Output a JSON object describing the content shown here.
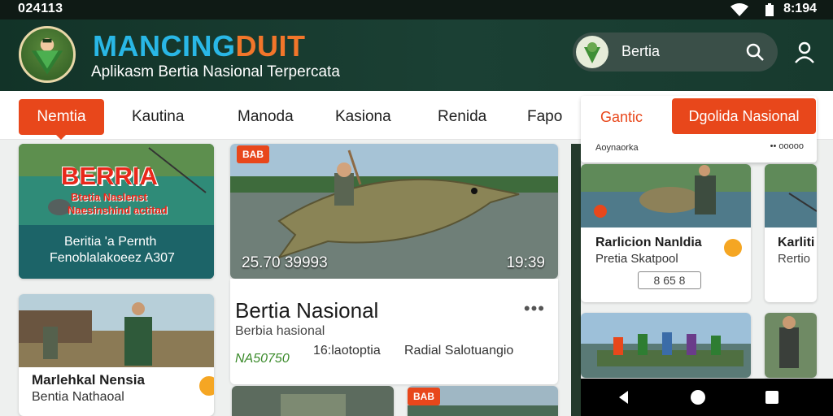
{
  "status_bar": {
    "time_left": "024113",
    "time_right": "8:194"
  },
  "header": {
    "title_part1": "MANCING",
    "title_part2": "DUIT",
    "subtitle": "Aplikasm Bertia Nasional Terpercata",
    "search_text": "Bertia"
  },
  "tabs": [
    "Nemtia",
    "Kautina",
    "Manoda",
    "Kasiona",
    "Renida",
    "Fapo"
  ],
  "dropdown": {
    "tab_label": "Gantic",
    "active_tab": "Dgolida Nasional",
    "label": "Aoynaorka",
    "dots": "•• ooooo"
  },
  "cards": {
    "banner": {
      "big_text": "BERRIA",
      "sub1": "Btetia Naslenst",
      "sub2": "Naesinshind actitad",
      "line1": "Beritia 'a Pernth",
      "line2": "Fenoblalakoeez A307"
    },
    "featured": {
      "badge": "BAB",
      "meta_left": "25.70 39993",
      "meta_right": "19:39"
    },
    "story_a": {
      "title": "Marlehkal Nensia",
      "desc": "Bentia Nathaoal"
    },
    "article": {
      "title": "Bertia Nasional",
      "more": "•••",
      "sub": "Berbia hasional",
      "num": "NA50750",
      "mid": "16:laotoptia",
      "right": "Radial Salotuangio"
    },
    "story_b": {
      "title": "Rarlicion Nanldia",
      "desc": "Pretia Skatpool",
      "stat": "8 65 8"
    },
    "story_c": {
      "title": "Karliti",
      "desc": "Rertio"
    },
    "bottom_badge": "BAB"
  },
  "colors": {
    "accent": "#e8471b",
    "header_bg": "#1b4034",
    "brand_blue": "#29b7e6",
    "brand_orange": "#f2762a"
  }
}
